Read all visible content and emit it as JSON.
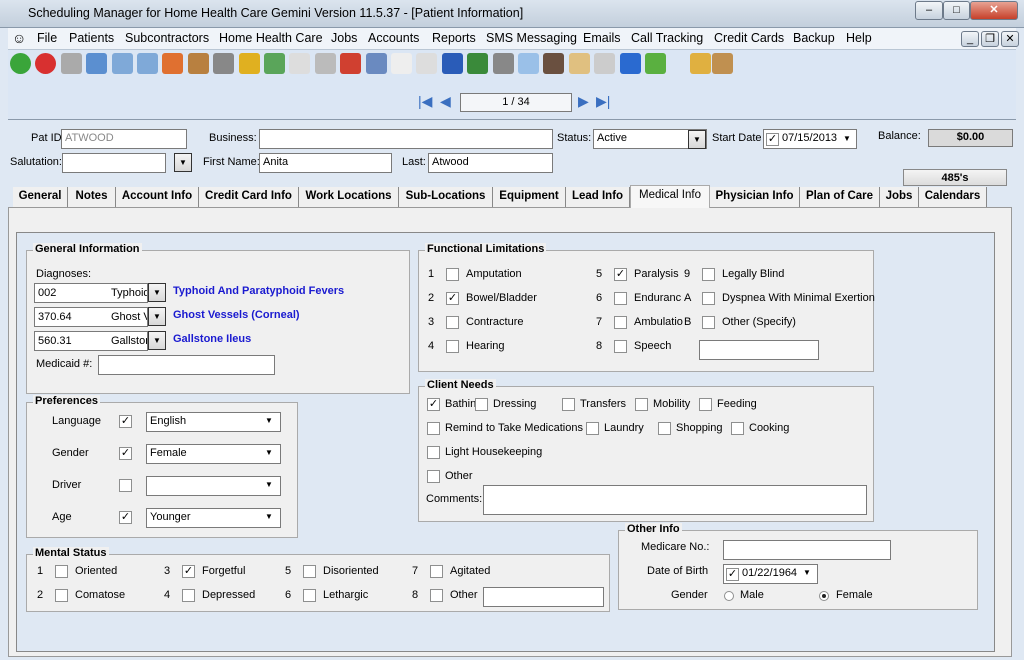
{
  "window": {
    "title": "Scheduling Manager for Home Health Care Gemini Version 11.5.37 - [Patient Information]"
  },
  "menu": [
    "File",
    "Patients",
    "Subcontractors",
    "Home Health Care",
    "Jobs",
    "Accounts",
    "Reports",
    "SMS Messaging",
    "Emails",
    "Call Tracking",
    "Credit Cards",
    "Backup",
    "Help"
  ],
  "toolbar_icons": [
    "add-icon",
    "delete-icon",
    "calculator-icon",
    "patient-icon",
    "calendar-add-icon",
    "calendar-search-icon",
    "calendar-icon",
    "home-icon",
    "car-icon",
    "pin-icon",
    "money-icon",
    "documents-icon",
    "phone-list-icon",
    "alarm-icon",
    "alarm-cancel-icon",
    "clock-icon",
    "checklist-icon",
    "word-icon",
    "globe-mail-icon",
    "print-icon",
    "email-icon",
    "contact-icon",
    "clipboard-icon",
    "search-icon",
    "undo-icon",
    "refresh-icon",
    "folder-icon",
    "exit-icon"
  ],
  "nav": {
    "record": "1 / 34"
  },
  "header": {
    "pat_id_label": "Pat ID:",
    "pat_id": "ATWOOD",
    "business_label": "Business:",
    "business": "",
    "status_label": "Status:",
    "status": "Active",
    "start_date_label": "Start Date",
    "start_date": "07/15/2013",
    "balance_label": "Balance:",
    "balance": "$0.00",
    "salutation_label": "Salutation:",
    "salutation": "",
    "first_name_label": "First Name:",
    "first_name": "Anita",
    "last_label": "Last:",
    "last": "Atwood",
    "btn_485": "485's"
  },
  "tabs": [
    "General",
    "Notes",
    "Account Info",
    "Credit Card Info",
    "Work Locations",
    "Sub-Locations",
    "Equipment",
    "Lead Info",
    "Medical Info",
    "Physician Info",
    "Plan of Care",
    "Jobs",
    "Calendars"
  ],
  "active_tab": "Medical Info",
  "general": {
    "title": "General Information",
    "diagnoses_label": "Diagnoses:",
    "diagnoses": [
      {
        "code": "002",
        "short": "Typhoid",
        "desc": "Typhoid And Paratyphoid Fevers"
      },
      {
        "code": "370.64",
        "short": "Ghost V",
        "desc": "Ghost Vessels (Corneal)"
      },
      {
        "code": "560.31",
        "short": "Gallstor",
        "desc": "Gallstone Ileus"
      }
    ],
    "medicaid_label": "Medicaid #:",
    "medicaid": ""
  },
  "preferences": {
    "title": "Preferences",
    "rows": [
      {
        "label": "Language",
        "checked": true,
        "value": "English"
      },
      {
        "label": "Gender",
        "checked": true,
        "value": "Female"
      },
      {
        "label": "Driver",
        "checked": false,
        "value": ""
      },
      {
        "label": "Age",
        "checked": true,
        "value": "Younger"
      }
    ]
  },
  "functional": {
    "title": "Functional Limitations",
    "items": [
      {
        "num": "1",
        "label": "Amputation",
        "checked": false
      },
      {
        "num": "2",
        "label": "Bowel/Bladder",
        "checked": true
      },
      {
        "num": "3",
        "label": "Contracture",
        "checked": false
      },
      {
        "num": "4",
        "label": "Hearing",
        "checked": false
      },
      {
        "num": "5",
        "label": "Paralysis",
        "checked": true
      },
      {
        "num": "6",
        "label": "Enduranc",
        "checked": false
      },
      {
        "num": "7",
        "label": "Ambulatio",
        "checked": false
      },
      {
        "num": "8",
        "label": "Speech",
        "checked": false
      },
      {
        "num": "9",
        "label": "Legally Blind",
        "checked": false
      },
      {
        "num": "A",
        "label": "Dyspnea With Minimal Exertion",
        "checked": false
      },
      {
        "num": "B",
        "label": "Other (Specify)",
        "checked": false
      }
    ],
    "other_value": ""
  },
  "client_needs": {
    "title": "Client Needs",
    "items": [
      {
        "label": "Bathing",
        "checked": true
      },
      {
        "label": "Dressing",
        "checked": false
      },
      {
        "label": "Transfers",
        "checked": false
      },
      {
        "label": "Mobility",
        "checked": false
      },
      {
        "label": "Feeding",
        "checked": false
      },
      {
        "label": "Remind to Take Medications",
        "checked": false
      },
      {
        "label": "Laundry",
        "checked": false
      },
      {
        "label": "Shopping",
        "checked": false
      },
      {
        "label": "Cooking",
        "checked": false
      },
      {
        "label": "Light Housekeeping",
        "checked": false
      },
      {
        "label": "Other",
        "checked": false
      }
    ],
    "comments_label": "Comments:",
    "comments": ""
  },
  "mental": {
    "title": "Mental Status",
    "items": [
      {
        "num": "1",
        "label": "Oriented",
        "checked": false
      },
      {
        "num": "2",
        "label": "Comatose",
        "checked": false
      },
      {
        "num": "3",
        "label": "Forgetful",
        "checked": true
      },
      {
        "num": "4",
        "label": "Depressed",
        "checked": false
      },
      {
        "num": "5",
        "label": "Disoriented",
        "checked": false
      },
      {
        "num": "6",
        "label": "Lethargic",
        "checked": false
      },
      {
        "num": "7",
        "label": "Agitated",
        "checked": false
      },
      {
        "num": "8",
        "label": "Other",
        "checked": false
      }
    ],
    "other_value": ""
  },
  "other_info": {
    "title": "Other Info",
    "medicare_label": "Medicare No.:",
    "medicare": "",
    "dob_label": "Date of Birth",
    "dob": "01/22/1964",
    "gender_label": "Gender",
    "male": "Male",
    "female": "Female",
    "selected_gender": "Female"
  }
}
